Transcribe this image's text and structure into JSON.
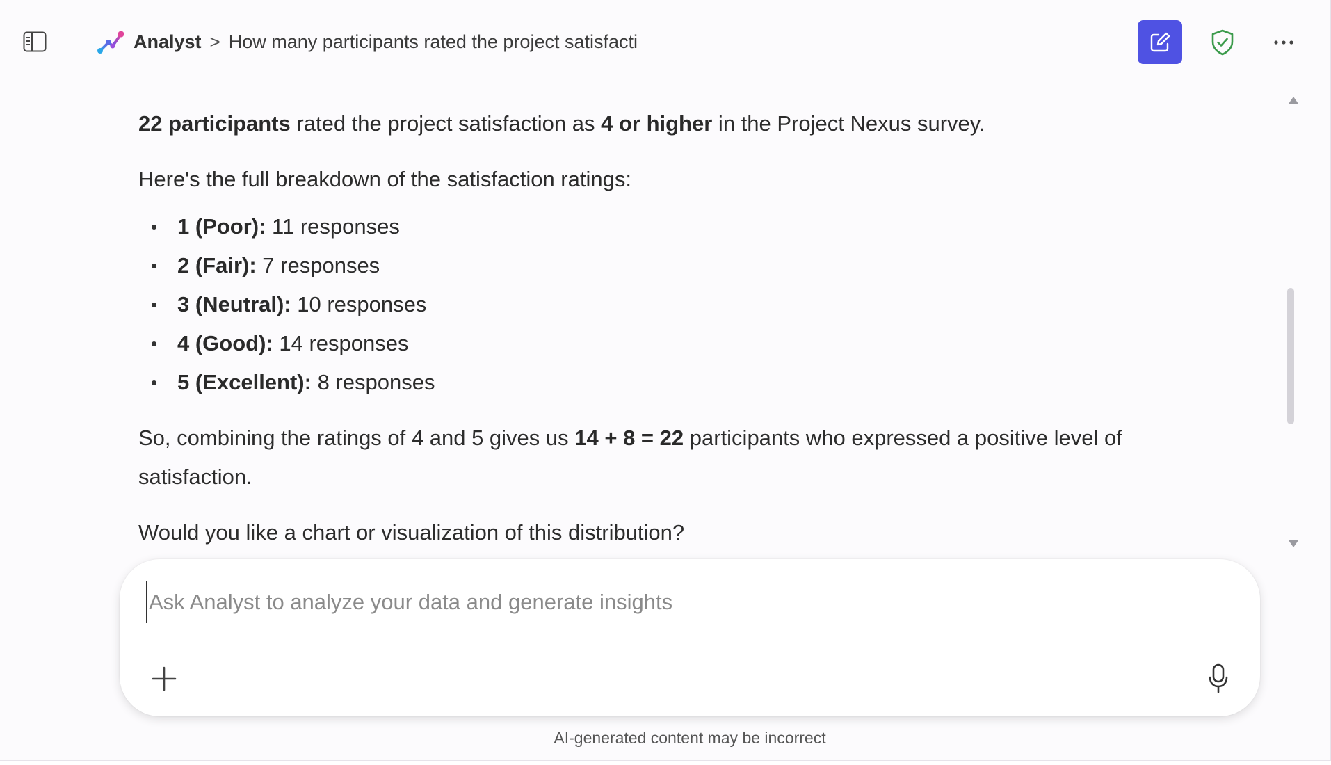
{
  "header": {
    "app_name": "Analyst",
    "separator": ">",
    "conversation_title": "How many participants rated the project satisfacti"
  },
  "message": {
    "intro": {
      "bold1": "22 participants",
      "text1": " rated the project satisfaction as ",
      "bold2": "4 or higher",
      "text2": " in the Project Nexus survey."
    },
    "breakdown_intro": "Here's the full breakdown of the satisfaction ratings:",
    "ratings": [
      {
        "label": "1 (Poor):",
        "value": " 11 responses"
      },
      {
        "label": "2 (Fair):",
        "value": " 7 responses"
      },
      {
        "label": "3 (Neutral):",
        "value": " 10 responses"
      },
      {
        "label": "4 (Good):",
        "value": " 14 responses"
      },
      {
        "label": "5 (Excellent):",
        "value": " 8 responses"
      }
    ],
    "summary": {
      "text1": "So, combining the ratings of 4 and 5 gives us ",
      "bold": "14 + 8 = 22",
      "text2": " participants who expressed a positive level of satisfaction."
    },
    "followup": "Would you like a chart or visualization of this distribution?"
  },
  "composer": {
    "placeholder": "Ask Analyst to analyze your data and generate insights",
    "value": ""
  },
  "disclaimer": "AI-generated content may be incorrect",
  "icons": {
    "sidebar_toggle": "sidebar-toggle-icon",
    "app_logo": "analyst-logo-icon",
    "new_chat": "compose-icon",
    "shield": "shield-check-icon",
    "more": "more-horizontal-icon",
    "add": "plus-icon",
    "mic": "microphone-icon"
  },
  "colors": {
    "accent": "#4f52e3",
    "shield": "#3a9a4a",
    "background": "#fcfbfd"
  }
}
